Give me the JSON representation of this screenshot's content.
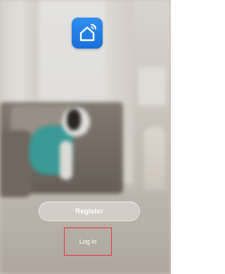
{
  "app": {
    "logo_icon": "smart-home-house-wifi-icon",
    "brand_color": "#2780e8"
  },
  "actions": {
    "register_label": "Register",
    "login_label": "Log in"
  },
  "highlight": {
    "color": "#e03a3a"
  }
}
